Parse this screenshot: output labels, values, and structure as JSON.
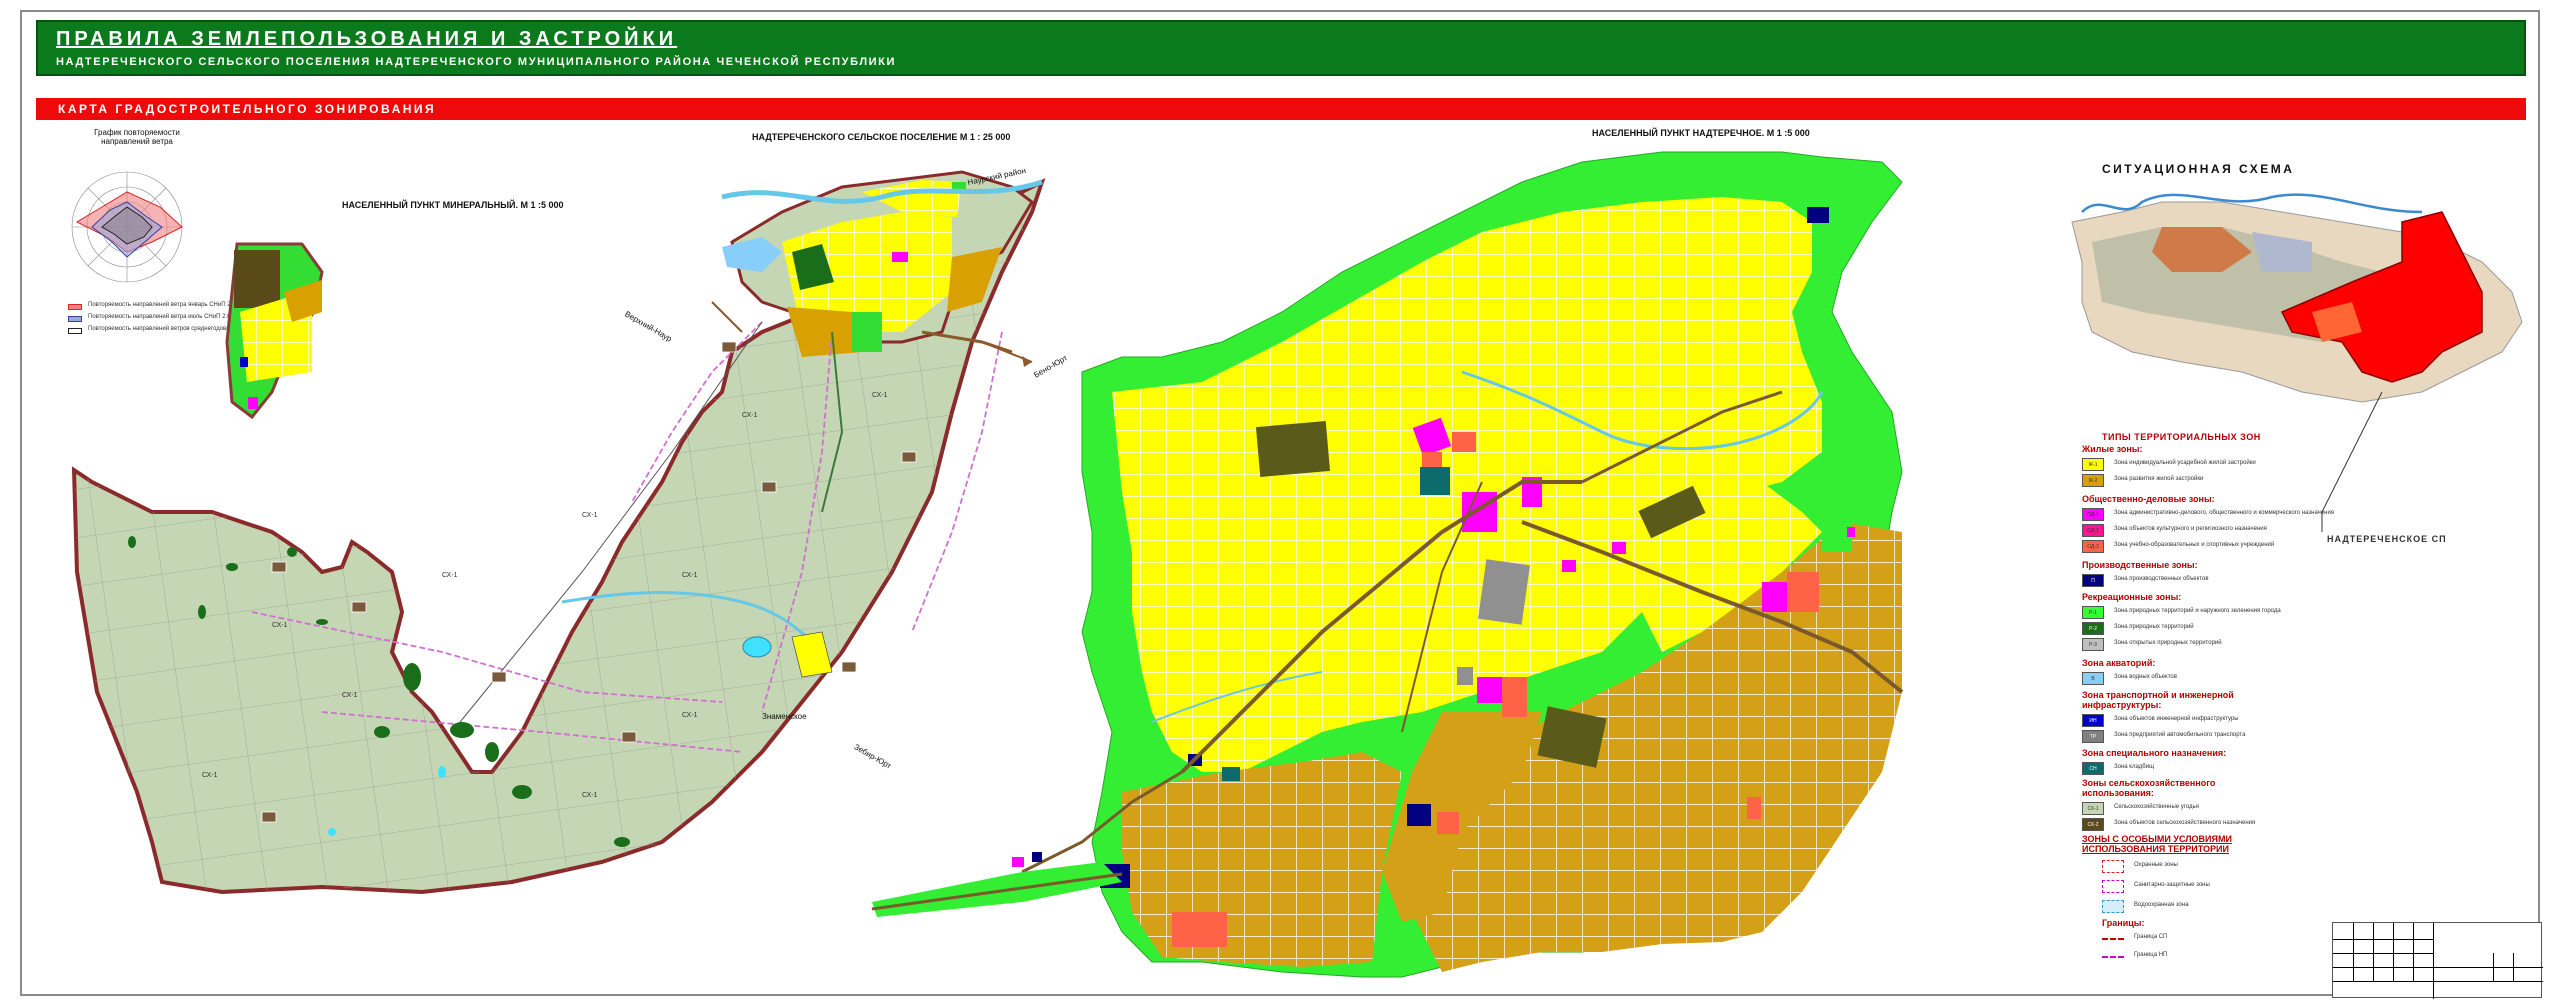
{
  "header": {
    "title": "ПРАВИЛА ЗЕМЛЕПОЛЬЗОВАНИЯ И ЗАСТРОЙКИ",
    "subtitle": "НАДТЕРЕЧЕНСКОГО СЕЛЬСКОГО ПОСЕЛЕНИЯ НАДТЕРЕЧЕНСКОГО МУНИЦИПАЛЬНОГО РАЙОНА  ЧЕЧЕНСКОЙ РЕСПУБЛИКИ"
  },
  "section_bar": {
    "label": "КАРТА ГРАДОСТРОИТЕЛЬНОГО ЗОНИРОВАНИЯ"
  },
  "wind_rose": {
    "title": "График повторяемости направлений ветра",
    "legend": [
      "Повторяемость направлений ветра январь СНиП 2.01.01-82",
      "Повторяемость направлений ветра июль СНиП 2.01.01-82",
      "Повторяемость направлений ветров среднегодовая СЛП Чеченской республики"
    ]
  },
  "maps": {
    "settlement_scale": "НАДТЕРЕЧЕНСКОГО СЕЛЬСКОЕ ПОСЕЛЕНИЕ М 1 : 25 000",
    "mineralny_scale": "НАСЕЛЕННЫЙ ПУНКТ МИНЕРАЛЬНЫЙ. М 1 :5 000",
    "nadterechnoe_scale": "НАСЕЛЕННЫЙ ПУНКТ НАДТЕРЕЧНОЕ. М 1 :5 000",
    "neighbors": [
      "Наурский район",
      "Верхний-Наур",
      "Знаменское",
      "Бено-Юрт",
      "Зебир-Юрт"
    ],
    "zone_code": "СХ-1"
  },
  "situation": {
    "title": "СИТУАЦИОННАЯ СХЕМА",
    "callout": "НАДТЕРЕЧЕНСКОЕ СП"
  },
  "legend": {
    "title": "ТИПЫ ТЕРРИТОРИАЛЬНЫХ ЗОН",
    "groups": [
      {
        "name": "Жилые зоны:",
        "items": [
          {
            "code": "Ж-1",
            "color": "#ffff00",
            "label": "Зона индивидуальной усадебной жилой застройки"
          },
          {
            "code": "Ж-2",
            "color": "#d8a000",
            "label": "Зона развития жилой застройки"
          }
        ]
      },
      {
        "name": "Общественно-деловые зоны:",
        "items": [
          {
            "code": "ОД-1",
            "color": "#ff00ff",
            "label": "Зона административно-делового, общественного и коммерческого назначения"
          },
          {
            "code": "ОД-2",
            "color": "#ff1493",
            "label": "Зона объектов культурного и религиозного назначения"
          },
          {
            "code": "ОД-3",
            "color": "#ff6347",
            "label": "Зона учебно-образовательных и спортивных учреждений"
          }
        ]
      },
      {
        "name": "Производственные зоны:",
        "items": [
          {
            "code": "П",
            "color": "#000080",
            "label": "Зона производственных объектов"
          }
        ]
      },
      {
        "name": "Рекреационные зоны:",
        "items": [
          {
            "code": "Р-1",
            "color": "#33ff33",
            "label": "Зона природных территорий и наружного зеленения города"
          },
          {
            "code": "Р-2",
            "color": "#1a6e1a",
            "label": "Зона природных территорий"
          },
          {
            "code": "Р-3",
            "color": "#bfbfbf",
            "label": "Зона открытых природных территорий"
          }
        ]
      },
      {
        "name": "Зона акваторий:",
        "items": [
          {
            "code": "В",
            "color": "#87cefa",
            "label": "Зона водных объектов"
          }
        ]
      },
      {
        "name": "Зона транспортной и инженерной инфраструктуры:",
        "items": [
          {
            "code": "ИН",
            "color": "#0000cc",
            "label": "Зона объектов инженерной инфраструктуры"
          },
          {
            "code": "ТР",
            "color": "#808080",
            "label": "Зона предприятий автомобильного транспорта"
          }
        ]
      },
      {
        "name": "Зона специального назначения:",
        "items": [
          {
            "code": "СН",
            "color": "#0d6b6b",
            "label": "Зона кладбищ"
          }
        ]
      },
      {
        "name": "Зоны сельскохозяйственного использования:",
        "items": [
          {
            "code": "СХ-1",
            "color": "#c5d6b5",
            "label": "Сельскохозяйственные угодья"
          },
          {
            "code": "СХ-2",
            "color": "#5a4a1a",
            "label": "Зона объектов сельскохозяйственного назначения"
          }
        ]
      },
      {
        "name": "ЗОНЫ С ОСОБЫМИ УСЛОВИЯМИ ИСПОЛЬЗОВАНИЯ ТЕРРИТОРИИ",
        "items": [
          {
            "code": "",
            "color": "#ffffff",
            "label": "Охранные зоны"
          },
          {
            "code": "",
            "color": "#ffffff",
            "label": "Санитарно-защитные зоны"
          },
          {
            "code": "",
            "color": "#d6ecff",
            "label": "Водоохранная зона"
          }
        ]
      },
      {
        "name": "Границы:",
        "items": [
          {
            "code": "",
            "color": "#ffffff",
            "label": "Граница СП"
          },
          {
            "code": "",
            "color": "#ffffff",
            "label": "Граница НП"
          }
        ]
      }
    ]
  }
}
